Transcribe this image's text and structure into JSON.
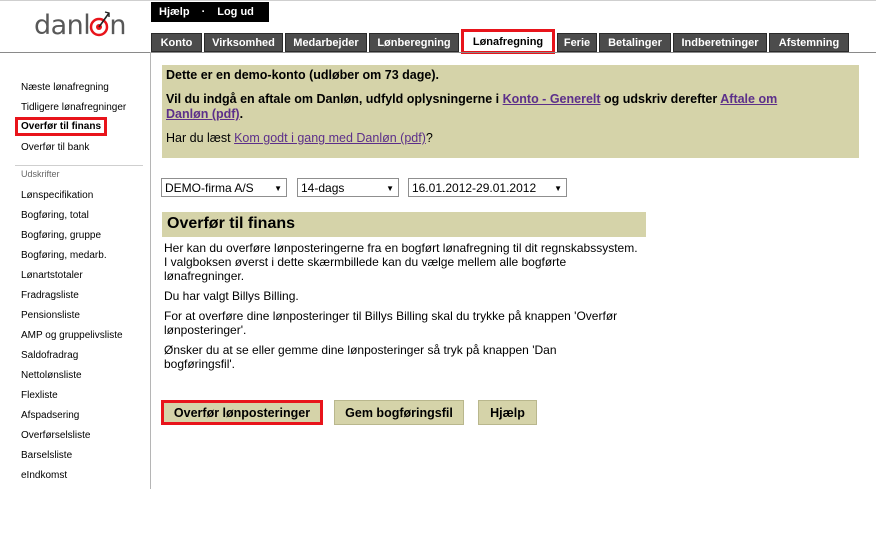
{
  "logo": {
    "text_left": "danl",
    "text_right": "n"
  },
  "header": {
    "help_label": "Hjælp",
    "separator": "·",
    "logout_label": "Log ud"
  },
  "tabs": [
    {
      "label": "Konto"
    },
    {
      "label": "Virksomhed"
    },
    {
      "label": "Medarbejder"
    },
    {
      "label": "Lønberegning"
    },
    {
      "label": "Lønafregning"
    },
    {
      "label": "Ferie"
    },
    {
      "label": "Betalinger"
    },
    {
      "label": "Indberetninger"
    },
    {
      "label": "Afstemning"
    }
  ],
  "sidebar": {
    "items": [
      {
        "label": "Næste lønafregning"
      },
      {
        "label": "Tidligere lønafregninger"
      },
      {
        "label": "Overfør til finans"
      },
      {
        "label": "Overfør til bank"
      }
    ],
    "section_label": "Udskrifter",
    "reports": [
      {
        "label": "Lønspecifikation"
      },
      {
        "label": "Bogføring, total"
      },
      {
        "label": "Bogføring, gruppe"
      },
      {
        "label": "Bogføring, medarb."
      },
      {
        "label": "Lønartstotaler"
      },
      {
        "label": "Fradragsliste"
      },
      {
        "label": "Pensionsliste"
      },
      {
        "label": "AMP og gruppelivsliste"
      },
      {
        "label": "Saldofradrag"
      },
      {
        "label": "Nettolønsliste"
      },
      {
        "label": "Flexliste"
      },
      {
        "label": "Afspadsering"
      },
      {
        "label": "Overførselsliste"
      },
      {
        "label": "Barselsliste"
      },
      {
        "label": "eIndkomst"
      }
    ]
  },
  "notice": {
    "demo_text": "Dette er en demo-konto (udløber om 73 dage).",
    "agreement_before": "Vil du indgå en aftale om Danløn, udfyld oplysningerne i ",
    "agreement_link1": "Konto - Generelt",
    "agreement_middle": " og udskriv derefter ",
    "agreement_link2_a": "Aftale om",
    "agreement_link2_b": "Danløn (pdf)",
    "agreement_after": ".",
    "read_before": "Har du læst ",
    "read_link": "Kom godt i gang med Danløn (pdf)",
    "read_after": "?"
  },
  "filters": {
    "company": "DEMO-firma A/S",
    "period_type": "14-dags",
    "period_range": "16.01.2012-29.01.2012"
  },
  "section": {
    "title": "Overfør til finans",
    "para1": "Her kan du overføre lønposteringerne fra en bogført lønafregning til dit regnskabssystem. I valgboksen øverst i dette skærmbillede kan du vælge mellem alle bogførte lønafregninger.",
    "para2": "Du har valgt Billys Billing.",
    "para3": "For at overføre dine lønposteringer til Billys Billing skal du trykke på knappen 'Overfør lønposteringer'.",
    "para4": "Ønsker du at se eller gemme dine lønposteringer så tryk på knappen 'Dan bogføringsfil'."
  },
  "buttons": {
    "transfer": "Overfør lønposteringer",
    "save": "Gem bogføringsfil",
    "help": "Hjælp"
  },
  "colors": {
    "accent_red": "#e8141b",
    "panel_beige": "#d5d3a9",
    "tab_dark": "#4c4c4c",
    "link_purple": "#5c2f8a"
  }
}
